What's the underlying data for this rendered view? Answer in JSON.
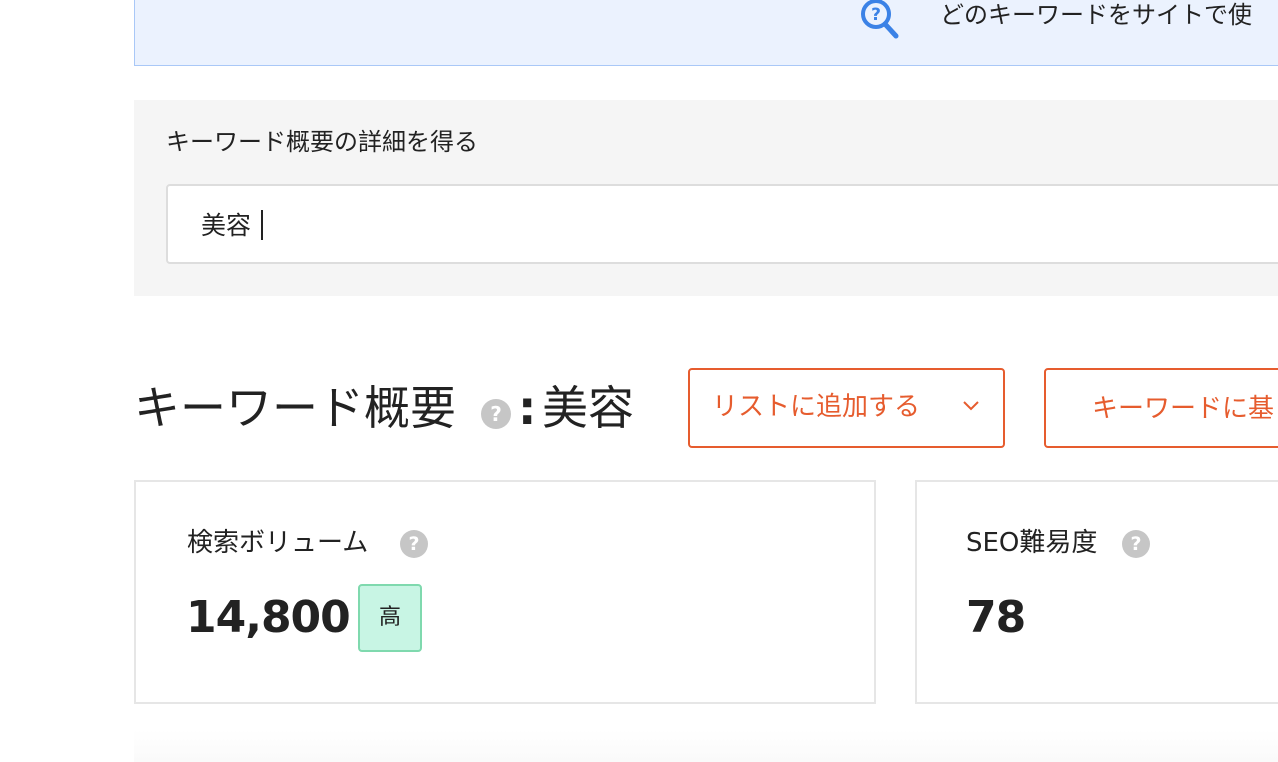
{
  "banner": {
    "text": "どのキーワードをサイトで使",
    "icon": "search-help-icon",
    "icon_color": "#3b82e6"
  },
  "search": {
    "label": "キーワード概要の詳細を得る",
    "value": "美容"
  },
  "overview": {
    "title": "キーワード概要",
    "help": "?",
    "colon": ":",
    "keyword": "美容"
  },
  "actions": {
    "add_to_list_label": "リストに追加する",
    "keyword_button_label": "キーワードに基",
    "accent_color": "#e65c2e"
  },
  "cards": {
    "volume": {
      "label": "検索ボリューム",
      "help": "?",
      "value": "14,800",
      "badge": "高",
      "badge_color": "#c8f5e4"
    },
    "seo": {
      "label": "SEO難易度",
      "help": "?",
      "value": "78"
    }
  }
}
